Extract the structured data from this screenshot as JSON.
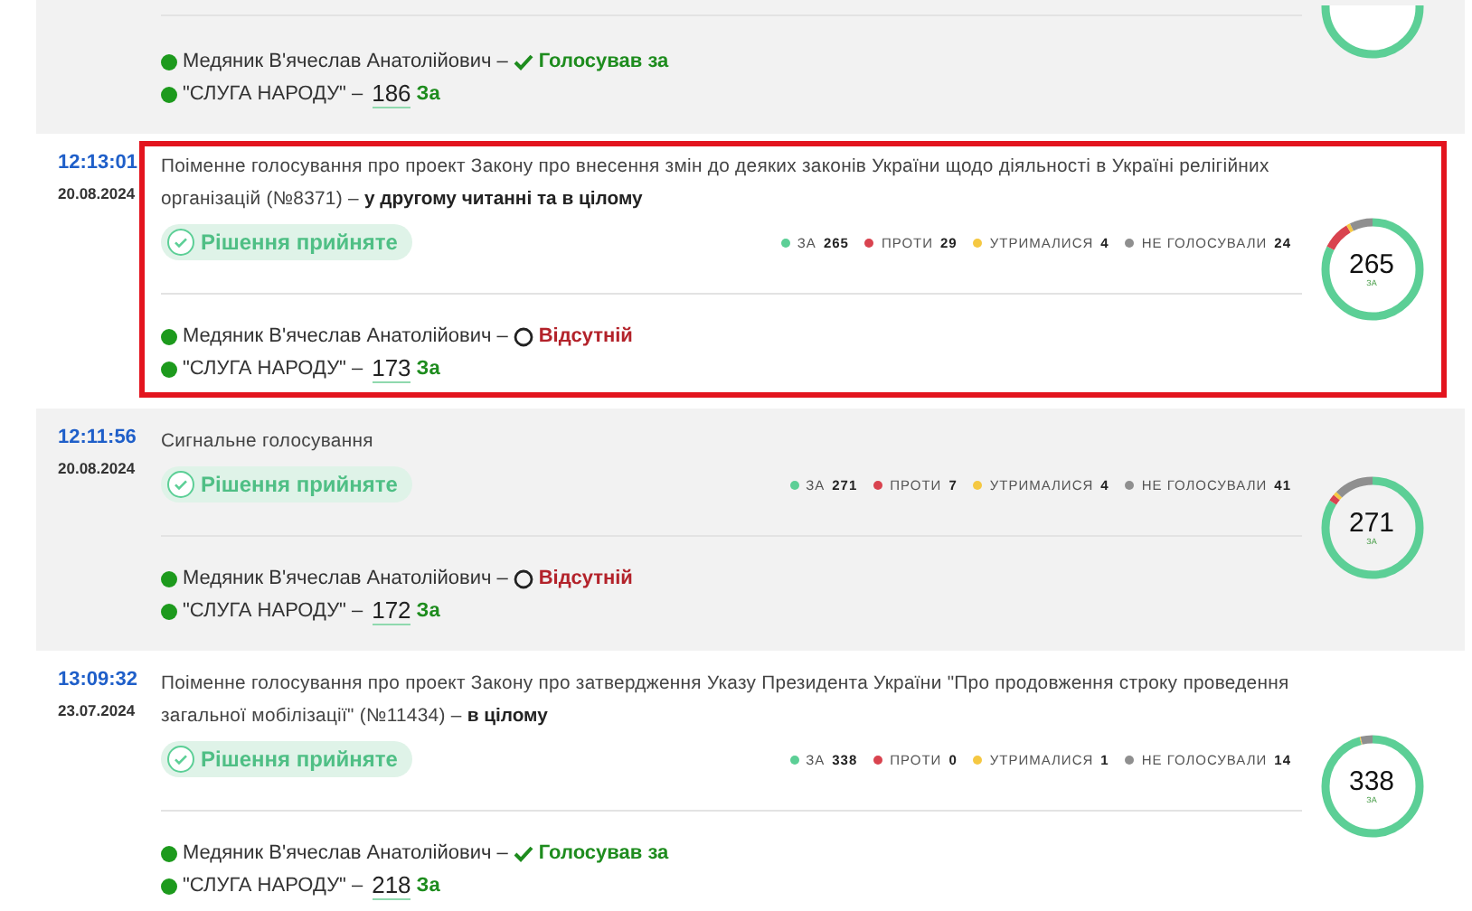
{
  "votes": [
    {
      "kind": "cut_off",
      "highlighted": false,
      "deputy": {
        "name": "Медяник В'ячеслав Анатолійович",
        "separator": "–",
        "kind": "voted_for",
        "status": "Голосував за"
      },
      "party": {
        "name": "\"СЛУГА НАРОДУ\"",
        "separator": "–",
        "count": "186",
        "label": "За"
      }
    },
    {
      "kind": "full",
      "highlighted": true,
      "time": "12:13:01",
      "date": "20.08.2024",
      "title": "Поіменне голосування про проект Закону про внесення змін до деяких законів України щодо діяльності в Україні релігійних організацій (№8371) – **у другому читанні та в цілому**",
      "decision": "Рішення прийняте",
      "legend": [
        {
          "label": "ЗА",
          "value": "265",
          "color": "#5ccf96"
        },
        {
          "label": "ПРОТИ",
          "value": "29",
          "color": "#d9434f"
        },
        {
          "label": "УТРИМАЛИСЯ",
          "value": "4",
          "color": "#f5c842"
        },
        {
          "label": "НЕ ГОЛОСУВАЛИ",
          "value": "24",
          "color": "#8f8f8f"
        }
      ],
      "ring": {
        "number": "265",
        "caption": "ЗА"
      },
      "deputy": {
        "name": "Медяник В'ячеслав Анатолійович",
        "separator": "–",
        "kind": "absent",
        "status": "Відсутній"
      },
      "party": {
        "name": "\"СЛУГА НАРОДУ\"",
        "separator": "–",
        "count": "173",
        "label": "За"
      }
    },
    {
      "kind": "full",
      "highlighted": false,
      "time": "12:11:56",
      "date": "20.08.2024",
      "title": "Сигнальне голосування",
      "decision": "Рішення прийняте",
      "legend": [
        {
          "label": "ЗА",
          "value": "271",
          "color": "#5ccf96"
        },
        {
          "label": "ПРОТИ",
          "value": "7",
          "color": "#d9434f"
        },
        {
          "label": "УТРИМАЛИСЯ",
          "value": "4",
          "color": "#f5c842"
        },
        {
          "label": "НЕ ГОЛОСУВАЛИ",
          "value": "41",
          "color": "#8f8f8f"
        }
      ],
      "ring": {
        "number": "271",
        "caption": "ЗА"
      },
      "deputy": {
        "name": "Медяник В'ячеслав Анатолійович",
        "separator": "–",
        "kind": "absent",
        "status": "Відсутній"
      },
      "party": {
        "name": "\"СЛУГА НАРОДУ\"",
        "separator": "–",
        "count": "172",
        "label": "За"
      }
    },
    {
      "kind": "full",
      "highlighted": false,
      "time": "13:09:32",
      "date": "23.07.2024",
      "title": "Поіменне голосування про проект Закону про затвердження Указу Президента України \"Про продовження строку проведення загальної мобілізації\" (№11434) – **в цілому**",
      "decision": "Рішення прийняте",
      "legend": [
        {
          "label": "ЗА",
          "value": "338",
          "color": "#5ccf96"
        },
        {
          "label": "ПРОТИ",
          "value": "0",
          "color": "#d9434f"
        },
        {
          "label": "УТРИМАЛИСЯ",
          "value": "1",
          "color": "#f5c842"
        },
        {
          "label": "НЕ ГОЛОСУВАЛИ",
          "value": "14",
          "color": "#8f8f8f"
        }
      ],
      "ring": {
        "number": "338",
        "caption": "ЗА"
      },
      "deputy": {
        "name": "Медяник В'ячеслав Анатолійович",
        "separator": "–",
        "kind": "voted_for",
        "status": "Голосував за"
      },
      "party": {
        "name": "\"СЛУГА НАРОДУ\"",
        "separator": "–",
        "count": "218",
        "label": "За"
      }
    }
  ]
}
